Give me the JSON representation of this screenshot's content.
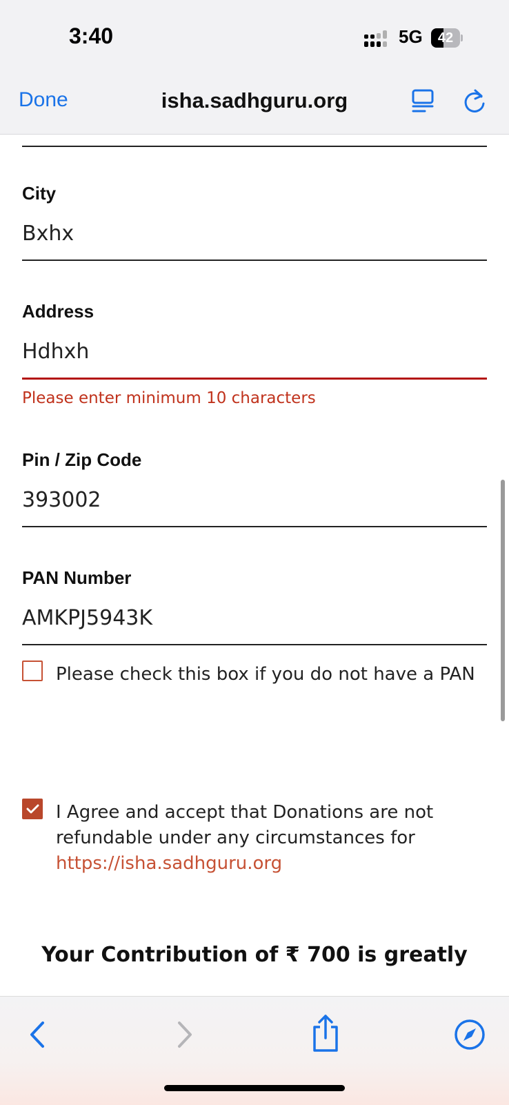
{
  "status_bar": {
    "time": "3:40",
    "network": "5G",
    "battery": "42",
    "battery_level_percent": 42
  },
  "browser": {
    "done_label": "Done",
    "url": "isha.sadhguru.org"
  },
  "form": {
    "city": {
      "label": "City",
      "value": "Bxhx"
    },
    "address": {
      "label": "Address",
      "value": "Hdhxh",
      "error": "Please enter minimum 10 characters"
    },
    "pin": {
      "label": "Pin / Zip Code",
      "value": "393002"
    },
    "pan": {
      "label": "PAN Number",
      "value": "AMKPJ5943K"
    },
    "no_pan_checkbox": {
      "label": "Please check this box if you do not have a PAN",
      "checked": false
    },
    "agree_checkbox": {
      "label": "I Agree and accept that Donations are not refundable under any circumstances for ",
      "link": "https://isha.sadhguru.org",
      "checked": true
    },
    "contribution_text": "Your Contribution of ₹ 700 is greatly"
  },
  "colors": {
    "accent": "#1a73e8",
    "error": "#c0321c",
    "checkbox": "#b9472b"
  },
  "icons": [
    "back-icon",
    "forward-icon",
    "share-icon",
    "compass-icon",
    "reader-icon",
    "reload-icon"
  ]
}
